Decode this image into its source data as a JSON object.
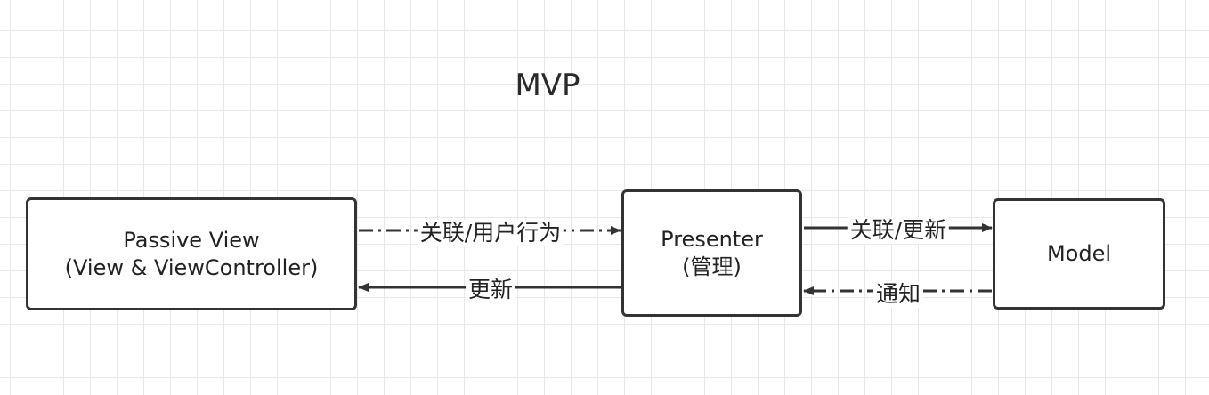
{
  "diagram": {
    "title": "MVP",
    "nodes": {
      "view": {
        "line1": "Passive View",
        "line2": "(View & ViewController)"
      },
      "presenter": {
        "line1": "Presenter",
        "line2": "(管理)"
      },
      "model": {
        "line1": "Model"
      }
    },
    "edges": [
      {
        "id": "view-to-presenter",
        "from": "view",
        "to": "presenter",
        "label": "关联/用户行为",
        "style": "dash-dot"
      },
      {
        "id": "presenter-to-view",
        "from": "presenter",
        "to": "view",
        "label": "更新",
        "style": "solid"
      },
      {
        "id": "presenter-to-model",
        "from": "presenter",
        "to": "model",
        "label": "关联/更新",
        "style": "solid"
      },
      {
        "id": "model-to-presenter",
        "from": "model",
        "to": "presenter",
        "label": "通知",
        "style": "dash-dot"
      }
    ],
    "colors": {
      "stroke": "#333333",
      "grid": "#e8e8e8",
      "background": "#ffffff"
    }
  }
}
